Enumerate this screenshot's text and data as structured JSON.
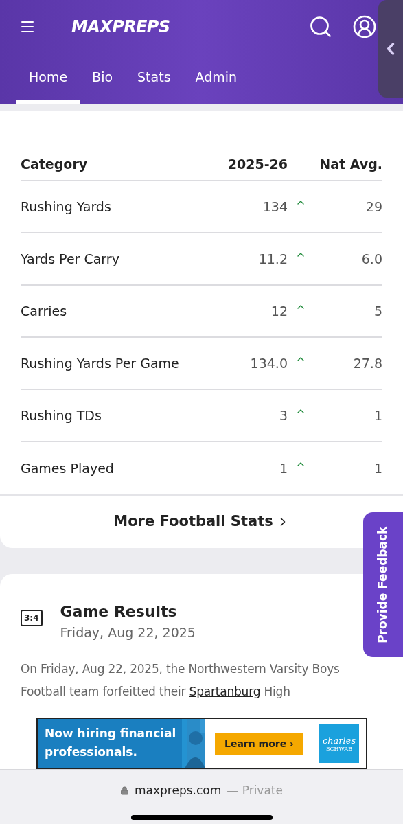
{
  "header": {
    "logo": "MAXPREPS"
  },
  "tabs": [
    {
      "label": "Home",
      "selected": true
    },
    {
      "label": "Bio",
      "selected": false
    },
    {
      "label": "Stats",
      "selected": false
    },
    {
      "label": "Admin",
      "selected": false
    }
  ],
  "stats_table": {
    "columns": [
      "Category",
      "2025-26",
      "Nat Avg."
    ],
    "rows": [
      {
        "category": "Rushing Yards",
        "value": "134",
        "above_average": true,
        "nat_avg": "29"
      },
      {
        "category": "Yards Per Carry",
        "value": "11.2",
        "above_average": true,
        "nat_avg": "6.0"
      },
      {
        "category": "Carries",
        "value": "12",
        "above_average": true,
        "nat_avg": "5"
      },
      {
        "category": "Rushing Yards Per Game",
        "value": "134.0",
        "above_average": true,
        "nat_avg": "27.8"
      },
      {
        "category": "Rushing TDs",
        "value": "3",
        "above_average": true,
        "nat_avg": "1"
      },
      {
        "category": "Games Played",
        "value": "1",
        "above_average": true,
        "nat_avg": "1"
      }
    ],
    "more_link": "More Football Stats"
  },
  "feedback_tab": "Provide Feedback",
  "game_results": {
    "icon_text": "3:4",
    "title": "Game Results",
    "date": "Friday, Aug 22, 2025",
    "paragraph": [
      {
        "kind": "text",
        "text": "On Friday, Aug 22, 2025, the Northwestern Varsity Boys Football team forfeitted their "
      },
      {
        "kind": "link",
        "text": "Spartanburg"
      },
      {
        "kind": "text",
        "text": " High"
      }
    ]
  },
  "ad": {
    "headline": "Now hiring financial professionals.",
    "button": "Learn more ›",
    "brand_top": "charles",
    "brand_bottom": "SCHWAB"
  },
  "browser_bar": {
    "domain": "maxpreps.com",
    "suffix": "— Private"
  }
}
